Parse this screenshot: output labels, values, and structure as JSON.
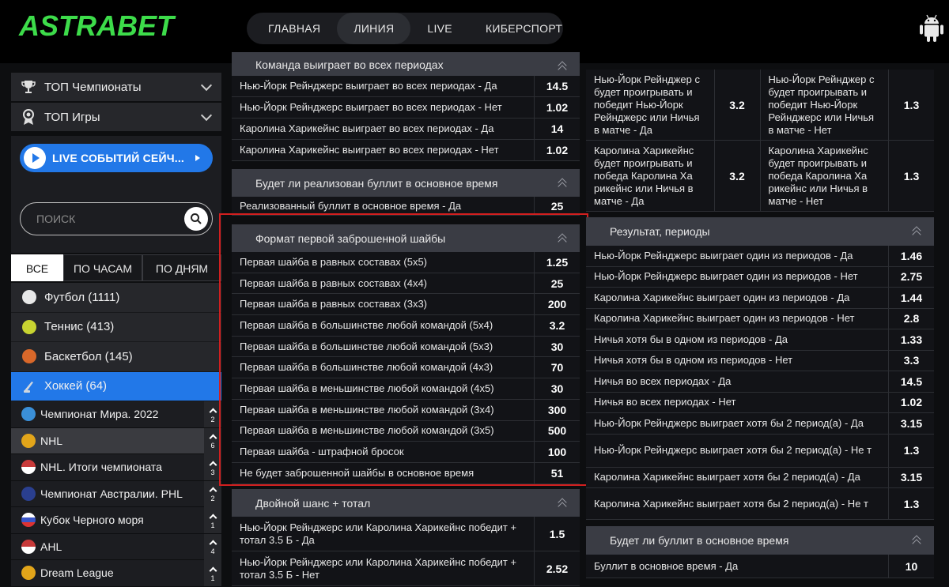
{
  "header": {
    "logo_text": "ASTRABET",
    "nav": [
      "ГЛАВНАЯ",
      "ЛИНИЯ",
      "LIVE",
      "КИБЕРСПОРТ"
    ],
    "active_nav": "ЛИНИЯ"
  },
  "sidebar": {
    "menu": [
      {
        "label": "ТОП Чемпионаты",
        "icon": "trophy-icon"
      },
      {
        "label": "ТОП Игры",
        "icon": "medal-icon"
      }
    ],
    "live_button": "LIVE СОБЫТИЙ СЕЙЧ...",
    "search_placeholder": "ПОИСК",
    "tabs": [
      "ВСЕ",
      "ПО ЧАСАМ",
      "ПО ДНЯМ"
    ],
    "sports": [
      {
        "label": "Футбол (1111)",
        "icon": "football-icon",
        "color": "#e8e8e8"
      },
      {
        "label": "Теннис (413)",
        "icon": "tennis-ball-icon",
        "color": "#c8d431"
      },
      {
        "label": "Баскетбол (145)",
        "icon": "basketball-icon",
        "color": "#d9682a"
      },
      {
        "label": "Хоккей (64)",
        "icon": "hockey-icon",
        "color": "#9aa4b0"
      }
    ],
    "leagues": [
      {
        "label": "Чемпионат Мира. 2022",
        "count": "2",
        "icon": "globe-icon",
        "color": "#3a8fd8"
      },
      {
        "label": "NHL",
        "count": "6",
        "icon": "info-icon",
        "color": "#e2a51a"
      },
      {
        "label": "NHL. Итоги чемпионата",
        "count": "3",
        "icon": "us-flag-icon",
        "color": "#c83a3a"
      },
      {
        "label": "Чемпионат Австралии. PHL",
        "count": "2",
        "icon": "au-flag-icon",
        "color": "#2a3f8f"
      },
      {
        "label": "Кубок Черного моря",
        "count": "1",
        "icon": "ru-flag-icon",
        "color": "#3a55c8"
      },
      {
        "label": "AHL",
        "count": "4",
        "icon": "us-flag-icon",
        "color": "#c83a3a"
      },
      {
        "label": "Dream League",
        "count": "1",
        "icon": "trophy-icon",
        "color": "#e2a51a"
      }
    ]
  },
  "col1": {
    "m1": {
      "title": "Команда выиграет во всех периодах",
      "rows": [
        {
          "label": "Нью-Йорк Рейнджерс выиграет во всех периодах - Да",
          "odd": "14.5"
        },
        {
          "label": "Нью-Йорк Рейнджерс выиграет во всех периодах - Нет",
          "odd": "1.02"
        },
        {
          "label": "Каролина Харикейнс выиграет во всех периодах - Да",
          "odd": "14"
        },
        {
          "label": "Каролина Харикейнс выиграет во всех периодах - Нет",
          "odd": "1.02"
        }
      ]
    },
    "m2": {
      "title": "Будет ли реализован буллит в основное время",
      "rows": [
        {
          "label": "Реализованный буллит в основное время - Да",
          "odd": "25"
        }
      ]
    },
    "m3": {
      "title": "Формат первой заброшенной шайбы",
      "rows": [
        {
          "label": "Первая шайба в равных составах (5х5)",
          "odd": "1.25"
        },
        {
          "label": "Первая шайба в равных составах (4х4)",
          "odd": "25"
        },
        {
          "label": "Первая шайба в равных составах (3х3)",
          "odd": "200"
        },
        {
          "label": "Первая шайба в большинстве любой командой (5х4)",
          "odd": "3.2"
        },
        {
          "label": "Первая шайба в большинстве любой командой (5х3)",
          "odd": "30"
        },
        {
          "label": "Первая шайба в большинстве любой командой (4х3)",
          "odd": "70"
        },
        {
          "label": "Первая шайба в меньшинстве любой командой (4х5)",
          "odd": "30"
        },
        {
          "label": "Первая шайба в меньшинстве любой командой (3х4)",
          "odd": "300"
        },
        {
          "label": "Первая шайба в меньшинстве любой командой (3х5)",
          "odd": "500"
        },
        {
          "label": "Первая шайба - штрафной бросок",
          "odd": "100"
        },
        {
          "label": "Не будет заброшенной шайбы в основное время",
          "odd": "51"
        }
      ]
    },
    "m4": {
      "title": "Двойной шанс + тотал",
      "rows": [
        {
          "label": "Нью-Йорк Рейнджерс или Каролина Харикейнс победит + тотал 3.5 Б - Да",
          "odd": "1.5"
        },
        {
          "label": "Нью-Йорк Рейнджерс или Каролина Харикейнс победит + тотал 3.5 Б - Нет",
          "odd": "2.52"
        }
      ]
    }
  },
  "col2": {
    "grid": [
      [
        {
          "label": "Нью-Йорк Рейнджер с будет проигрывать и победит Нью-Йорк Рейнджерс или Ничья в матче - Да",
          "odd": "3.2"
        },
        {
          "label": "Нью-Йорк Рейнджер с будет проигрывать и победит Нью-Йорк Рейнджерс или Ничья в матче - Нет",
          "odd": "1.3"
        }
      ],
      [
        {
          "label": "Каролина Харикейнс будет проигрывать и победа Каролина Ха рикейнс или Ничья в матче - Да",
          "odd": "3.2"
        },
        {
          "label": "Каролина Харикейнс будет проигрывать и победа Каролина Ха рикейнс или Ничья в матче - Нет",
          "odd": "1.3"
        }
      ]
    ],
    "m5": {
      "title": "Результат, периоды",
      "rows": [
        {
          "label": "Нью-Йорк Рейнджерс выиграет один из периодов - Да",
          "odd": "1.46"
        },
        {
          "label": "Нью-Йорк Рейнджерс выиграет один из периодов - Нет",
          "odd": "2.75"
        },
        {
          "label": "Каролина Харикейнс выиграет один из периодов - Да",
          "odd": "1.44"
        },
        {
          "label": "Каролина Харикейнс выиграет один из периодов - Нет",
          "odd": "2.8"
        },
        {
          "label": "Ничья хотя бы в одном из периодов - Да",
          "odd": "1.33"
        },
        {
          "label": "Ничья хотя бы в одном из периодов - Нет",
          "odd": "3.3"
        },
        {
          "label": "Ничья во всех периодах - Да",
          "odd": "14.5"
        },
        {
          "label": "Ничья во всех периодах - Нет",
          "odd": "1.02"
        },
        {
          "label": "Нью-Йорк Рейнджерс выиграет хотя бы 2 период(а) - Да",
          "odd": "3.15"
        },
        {
          "label": "Нью-Йорк Рейнджерс выиграет хотя бы 2 период(а) - Не т",
          "odd": "1.3"
        },
        {
          "label": "Каролина Харикейнс выиграет хотя бы 2 период(а) - Да",
          "odd": "3.15"
        },
        {
          "label": "Каролина Харикейнс выиграет хотя бы 2 период(а) - Не т",
          "odd": "1.3"
        }
      ]
    },
    "m6": {
      "title": "Будет ли буллит в основное время",
      "rows": [
        {
          "label": "Буллит в основное время - Да",
          "odd": "10"
        }
      ]
    }
  },
  "colors": {
    "accent": "#2278e8",
    "highlight": "#d21f1f",
    "logo_green": "#3ddc4a"
  }
}
